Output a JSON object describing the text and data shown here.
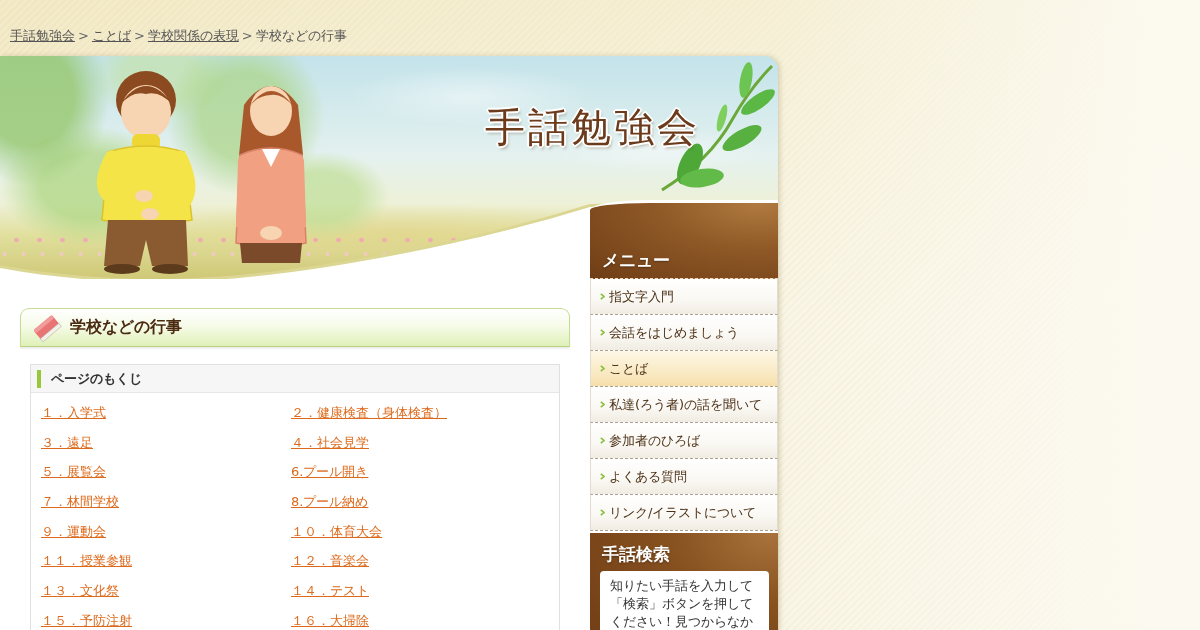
{
  "breadcrumb": {
    "items": [
      {
        "label": "手話勉強会",
        "link": true
      },
      {
        "label": "ことば",
        "link": true
      },
      {
        "label": "学校関係の表現",
        "link": true
      },
      {
        "label": "学校などの行事",
        "link": false
      }
    ],
    "separators": [
      ">",
      ">",
      ">"
    ]
  },
  "header": {
    "site_title": "手話勉強会"
  },
  "content": {
    "page_title": "学校などの行事",
    "toc": {
      "title": "ページのもくじ",
      "links": [
        "１．入学式",
        "２．健康検査（身体検査）",
        "３．遠足",
        "４．社会見学",
        "５．展覧会",
        "6.プール開き",
        "７．林間学校",
        "8.プール納め",
        "９．運動会",
        "１０．体育大会",
        "１１．授業参観",
        "１２．音楽会",
        "１３．文化祭",
        "１４．テスト",
        "１５．予防注射",
        "１６．大掃除"
      ]
    }
  },
  "sidebar": {
    "menu": {
      "title": "メニュー",
      "items": [
        {
          "label": "指文字入門",
          "selected": false
        },
        {
          "label": "会話をはじめましょう",
          "selected": false
        },
        {
          "label": "ことば",
          "selected": true
        },
        {
          "label": "私達(ろう者)の話を聞いて",
          "selected": false
        },
        {
          "label": "参加者のひろば",
          "selected": false
        },
        {
          "label": "よくある質問",
          "selected": false
        },
        {
          "label": "リンク/イラストについて",
          "selected": false
        }
      ]
    },
    "search": {
      "title": "手話検索",
      "description": "知りたい手話を入力して「検索」ボタンを押してください！見つからなか"
    }
  }
}
